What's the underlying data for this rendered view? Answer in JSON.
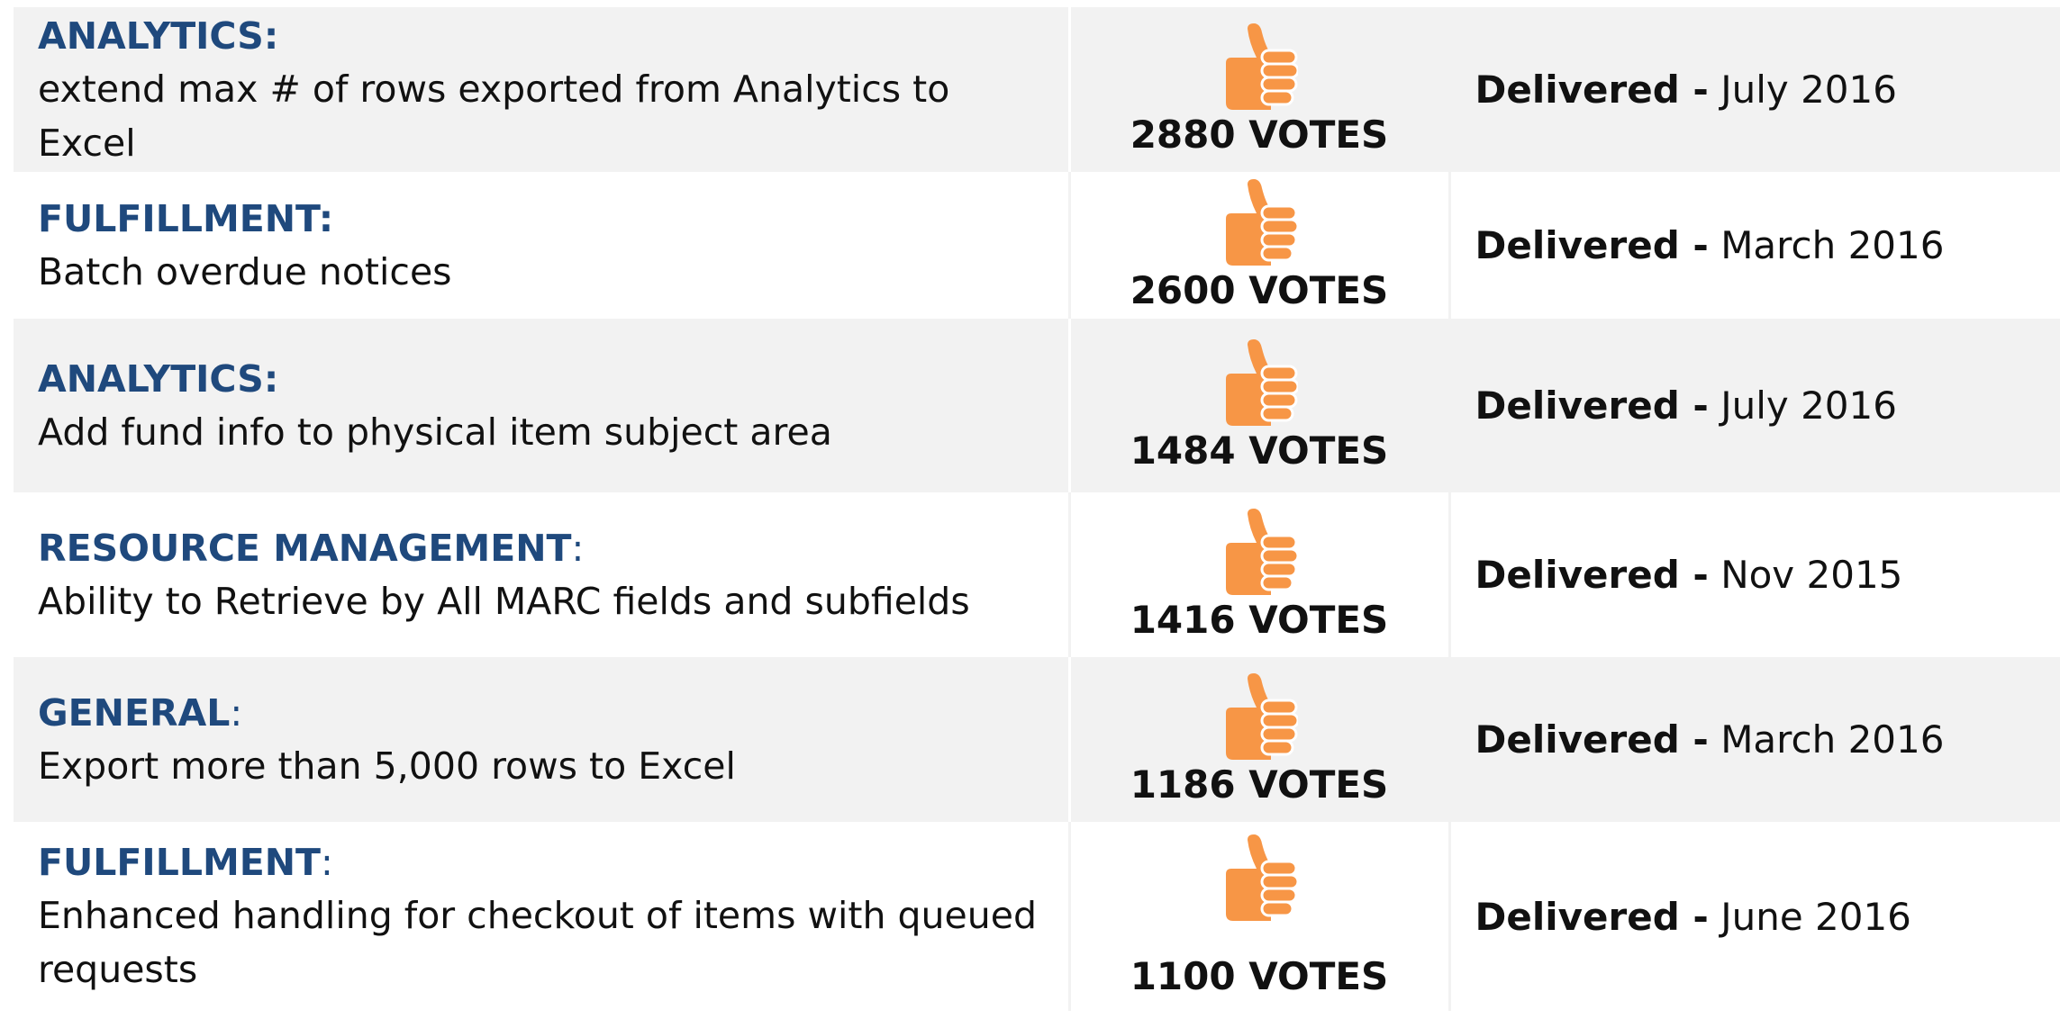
{
  "rows": [
    {
      "category": "ANALYTICS",
      "colon_bold": true,
      "description": "extend max # of rows exported from Analytics to Excel",
      "votes": "2880 VOTES",
      "status": "Delivered -",
      "date": "July 2016"
    },
    {
      "category": "FULFILLMENT",
      "colon_bold": true,
      "description": "Batch overdue notices",
      "votes": "2600 VOTES",
      "status": "Delivered -",
      "date": "March 2016"
    },
    {
      "category": "ANALYTICS",
      "colon_bold": true,
      "description": "Add fund info to physical item subject area",
      "votes": "1484 VOTES",
      "status": "Delivered -",
      "date": "July 2016"
    },
    {
      "category": "RESOURCE MANAGEMENT",
      "colon_bold": false,
      "description": "Ability to Retrieve by All MARC fields and subfields",
      "votes": "1416 VOTES",
      "status": "Delivered -",
      "date": "Nov 2015"
    },
    {
      "category": "GENERAL",
      "colon_bold": false,
      "description": "Export more than 5,000 rows to Excel",
      "votes": "1186 VOTES",
      "status": "Delivered -",
      "date": "March 2016"
    },
    {
      "category": "FULFILLMENT",
      "colon_bold": false,
      "description": "Enhanced handling for checkout of items with queued requests",
      "votes": "1100 VOTES",
      "status": "Delivered -",
      "date": "June 2016"
    }
  ],
  "colon": ":",
  "icon": "thumbs-up-icon",
  "colors": {
    "category": "#1f497d",
    "thumb": "#f79646",
    "shade": "#f2f2f2"
  }
}
